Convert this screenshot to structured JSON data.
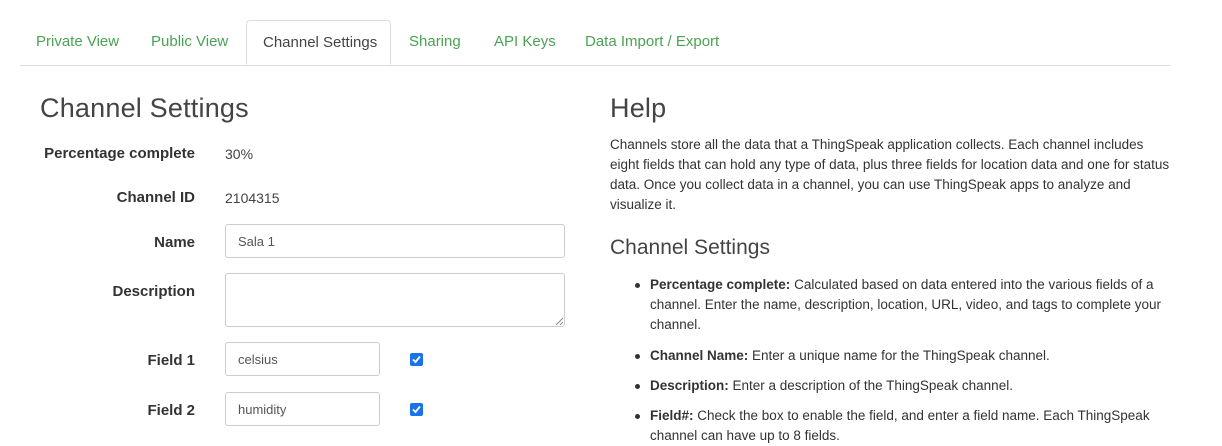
{
  "tabs": [
    {
      "label": "Private View"
    },
    {
      "label": "Public View"
    },
    {
      "label": "Channel Settings"
    },
    {
      "label": "Sharing"
    },
    {
      "label": "API Keys"
    },
    {
      "label": "Data Import / Export"
    }
  ],
  "settings": {
    "title": "Channel Settings",
    "percentage_label": "Percentage complete",
    "percentage_value": "30%",
    "channel_id_label": "Channel ID",
    "channel_id_value": "2104315",
    "name_label": "Name",
    "name_value": "Sala 1",
    "description_label": "Description",
    "description_value": "",
    "field1_label": "Field 1",
    "field1_value": "celsius",
    "field1_enabled": true,
    "field2_label": "Field 2",
    "field2_value": "humidity",
    "field2_enabled": true
  },
  "help": {
    "title": "Help",
    "intro": "Channels store all the data that a ThingSpeak application collects. Each channel includes eight fields that can hold any type of data, plus three fields for location data and one for status data. Once you collect data in a channel, you can use ThingSpeak apps to analyze and visualize it.",
    "subtitle": "Channel Settings",
    "items": [
      {
        "term": "Percentage complete:",
        "text": " Calculated based on data entered into the various fields of a channel. Enter the name, description, location, URL, video, and tags to complete your channel."
      },
      {
        "term": "Channel Name:",
        "text": " Enter a unique name for the ThingSpeak channel."
      },
      {
        "term": "Description:",
        "text": " Enter a description of the ThingSpeak channel."
      },
      {
        "term": "Field#:",
        "text": " Check the box to enable the field, and enter a field name. Each ThingSpeak channel can have up to 8 fields."
      }
    ]
  },
  "colors": {
    "tab_link": "#4aa352",
    "checkbox": "#1a73e8"
  }
}
